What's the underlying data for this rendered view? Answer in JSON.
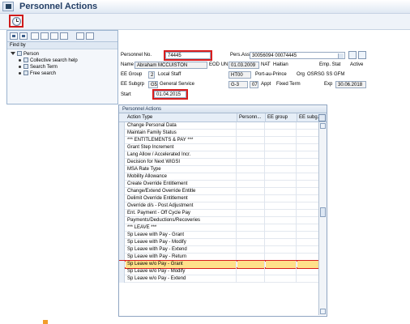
{
  "title": "Personnel Actions",
  "nav": {
    "find_by": "Find by",
    "tree": {
      "root": "Person",
      "items": [
        "Collective search help",
        "Search Term",
        "Free search"
      ]
    }
  },
  "form": {
    "personnel_no_label": "Personnel No.",
    "personnel_no_value": "74445",
    "pers_assign_label": "Pers.Assign",
    "pers_assign_value": "30056094 00074445",
    "name_label": "Name",
    "name_value": "Abraham MCCUISTON",
    "eod_label": "EOD UN",
    "eod_value": "01.03.2009",
    "nat_label": "NAT",
    "nat_value": "Haitian",
    "emp_stat_label": "Emp. Stat",
    "emp_stat_value": "Active",
    "ee_group_label": "EE Group",
    "ee_group_code": "2",
    "ee_group_text": "Local Staff",
    "ee_group_field": "HT00",
    "ee_group_city": "Port-au-Prince",
    "org_label": "Org",
    "org_value": "OSRSG SS GFM",
    "ee_subgrp_label": "EE Subgrp",
    "ee_subgrp_code": "G5",
    "ee_subgrp_text": "General Service",
    "grade_value": "G-3",
    "step_value": "07",
    "appt_label": "Appt",
    "appt_value": "Fixed Term",
    "exp_label": "Exp",
    "exp_value": "30.06.2018",
    "start_label": "Start",
    "start_value": "01.04.2015"
  },
  "table": {
    "title": "Personnel Actions",
    "headers": [
      "Action Type",
      "Personn...",
      "EE group",
      "EE subg..."
    ],
    "rows": [
      "Change Personal Data",
      "Maintain Family Status",
      "*** ENTITLEMENTS & PAY ***",
      "Grant Step Increment",
      "Lang Allow / Accelerated Incr.",
      "Decision for Next WIGSI",
      "MSA Rate Type",
      "Mobility Allowance",
      "Create Override Entitlement",
      "Change/Extend Override Entitle",
      "Delimit Override Entitlement",
      "Override d/s - Post Adjustment",
      "Ent. Payment - Off Cycle Pay",
      "Payments/Deductions/Recoveries",
      "*** LEAVE ***",
      "Sp Leave with Pay - Grant",
      "Sp Leave with Pay - Modify",
      "Sp Leave with Pay - Extend",
      "Sp Leave with Pay - Return",
      "Sp Leave w/o Pay - Grant",
      "Sp Leave w/o Pay - Modify",
      "Sp Leave w/o Pay - Extend"
    ],
    "highlighted_row": "Sp Leave w/o Pay - Grant"
  }
}
